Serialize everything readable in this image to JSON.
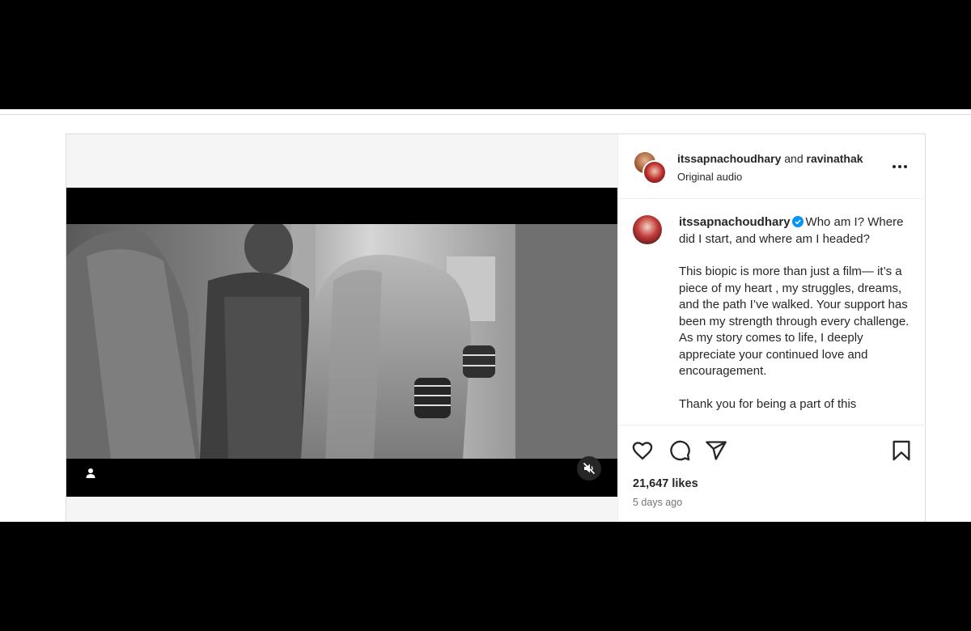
{
  "post": {
    "header": {
      "author_primary": "itssapnachoudhary",
      "joiner": "and",
      "author_collab": "ravinathak",
      "audio": "Original audio"
    },
    "caption": {
      "username": "itssapnachoudhary",
      "paragraphs": [
        "Who am I? Where did I start, and where am I headed?",
        "This biopic is more than just a film— it’s a piece of my heart , my struggles, dreams, and the path I’ve walked. Your support has been my strength through every challenge. As my story comes to life, I deeply appreciate your continued love and encouragement.",
        "Thank you for being a part of this"
      ]
    },
    "likes": "21,647 likes",
    "timestamp": "5 days ago",
    "verified_color": "#0095f6",
    "icons": {
      "more": "more-options-icon",
      "like": "heart-icon",
      "comment": "comment-icon",
      "share": "share-icon",
      "save": "bookmark-icon",
      "user_tag": "user-tag-icon",
      "mute": "muted-speaker-icon"
    }
  }
}
